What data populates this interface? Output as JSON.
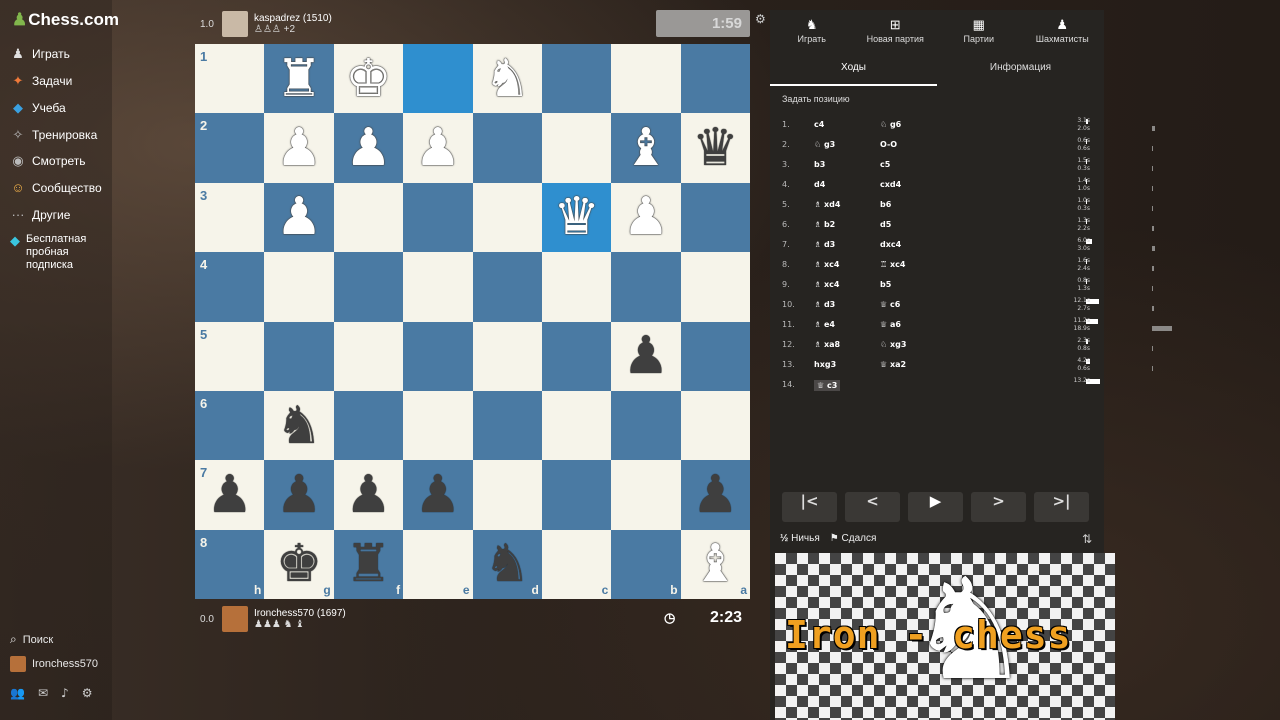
{
  "sidebar": {
    "logo": "Chess.com",
    "items": [
      {
        "label": "Играть",
        "icon": "play-icon"
      },
      {
        "label": "Задачи",
        "icon": "puzzle-icon"
      },
      {
        "label": "Учеба",
        "icon": "learn-icon"
      },
      {
        "label": "Тренировка",
        "icon": "training-icon"
      },
      {
        "label": "Смотреть",
        "icon": "watch-icon"
      },
      {
        "label": "Сообщество",
        "icon": "community-icon"
      },
      {
        "label": "Другие",
        "icon": "more-icon"
      }
    ],
    "promo": "Бесплатная пробная подписка",
    "search": "Поиск",
    "username": "Ironchess570"
  },
  "top_player": {
    "score": "1.0",
    "name": "kaspadrez (1510)",
    "captured": "♙♙♙ +2",
    "clock": "1:59"
  },
  "bottom_player": {
    "score": "0.0",
    "name": "Ironchess570 (1697)",
    "captured": "♟♟♟ ♞ ♝",
    "clock": "2:23"
  },
  "board": {
    "ranks": [
      "1",
      "2",
      "3",
      "4",
      "5",
      "6",
      "7",
      "8"
    ],
    "files": [
      "h",
      "g",
      "f",
      "e",
      "d",
      "c",
      "b",
      "a"
    ],
    "squares": [
      [
        "",
        "wR",
        "wK",
        "",
        "wN",
        "",
        "",
        ""
      ],
      [
        "",
        "wP",
        "wP",
        "wP",
        "",
        "",
        "wB",
        "bQ"
      ],
      [
        "",
        "wP",
        "",
        "",
        "",
        "wQ",
        "wP",
        ""
      ],
      [
        "",
        "",
        "",
        "",
        "",
        "",
        "",
        ""
      ],
      [
        "",
        "",
        "",
        "",
        "",
        "",
        "bP",
        ""
      ],
      [
        "",
        "bN",
        "",
        "",
        "",
        "",
        "",
        ""
      ],
      [
        "bP",
        "bP",
        "bP",
        "bP",
        "",
        "",
        "",
        "bP"
      ],
      [
        "",
        "bK",
        "bR",
        "",
        "bN",
        "",
        "",
        "wB"
      ]
    ],
    "highlighted": [
      [
        0,
        3
      ],
      [
        2,
        5
      ]
    ],
    "colors": {
      "light": "#f6f4ea",
      "dark": "#4a7aa3",
      "highlight": "#2f8fcf"
    }
  },
  "panel": {
    "top_tabs": [
      {
        "label": "Играть",
        "icon": "960-icon"
      },
      {
        "label": "Новая партия",
        "icon": "plus-icon"
      },
      {
        "label": "Партии",
        "icon": "games-icon"
      },
      {
        "label": "Шахматисты",
        "icon": "players-icon"
      }
    ],
    "sub_tabs": [
      "Ходы",
      "Информация"
    ],
    "set_position": "Задать позицию",
    "moves": [
      {
        "n": "1.",
        "w": "c4",
        "b": "♘ g6",
        "wt": "3.1s",
        "bt": "2.0s",
        "wbar": 0.05,
        "bbar": 0.06
      },
      {
        "n": "2.",
        "w": "♘ g3",
        "b": "O-O",
        "wt": "0.6s",
        "bt": "0.6s",
        "wbar": 0.02,
        "bbar": 0.02
      },
      {
        "n": "3.",
        "w": "b3",
        "b": "c5",
        "wt": "1.5s",
        "bt": "0.3s",
        "wbar": 0.03,
        "bbar": 0.01
      },
      {
        "n": "4.",
        "w": "d4",
        "b": "cxd4",
        "wt": "1.4s",
        "bt": "1.0s",
        "wbar": 0.03,
        "bbar": 0.02
      },
      {
        "n": "5.",
        "w": "♗ xd4",
        "b": "b6",
        "wt": "1.0s",
        "bt": "0.3s",
        "wbar": 0.02,
        "bbar": 0.01
      },
      {
        "n": "6.",
        "w": "♗ b2",
        "b": "d5",
        "wt": "1.3s",
        "bt": "2.2s",
        "wbar": 0.03,
        "bbar": 0.05
      },
      {
        "n": "7.",
        "w": "♗ d3",
        "b": "dxc4",
        "wt": "6.0s",
        "bt": "3.0s",
        "wbar": 0.12,
        "bbar": 0.06
      },
      {
        "n": "8.",
        "w": "♗ xc4",
        "b": "♖ xc4",
        "wt": "1.6s",
        "bt": "2.4s",
        "wbar": 0.03,
        "bbar": 0.05
      },
      {
        "n": "9.",
        "w": "♗ xc4",
        "b": "b5",
        "wt": "0.8s",
        "bt": "1.3s",
        "wbar": 0.02,
        "bbar": 0.03
      },
      {
        "n": "10.",
        "w": "♗ d3",
        "b": "♕ c6",
        "wt": "12.1s",
        "bt": "2.7s",
        "wbar": 0.28,
        "bbar": 0.05
      },
      {
        "n": "11.",
        "w": "♗ e4",
        "b": "♕ a6",
        "wt": "11.2s",
        "bt": "18.9s",
        "wbar": 0.24,
        "bbar": 0.42
      },
      {
        "n": "12.",
        "w": "♗ xa8",
        "b": "♘ xg3",
        "wt": "2.3s",
        "bt": "0.8s",
        "wbar": 0.05,
        "bbar": 0.02
      },
      {
        "n": "13.",
        "w": "hxg3",
        "b": "♕ xa2",
        "wt": "4.2s",
        "bt": "0.6s",
        "wbar": 0.09,
        "bbar": 0.02
      },
      {
        "n": "14.",
        "w": "♕ c3",
        "b": "",
        "wt": "13.2s",
        "bt": "",
        "wbar": 0.3,
        "bbar": 0
      }
    ],
    "nav_buttons": [
      "first",
      "prev",
      "play",
      "next",
      "last"
    ],
    "draw": "Ничья",
    "resign": "Сдался"
  },
  "webcam": {
    "brand": "Iron - chess"
  }
}
